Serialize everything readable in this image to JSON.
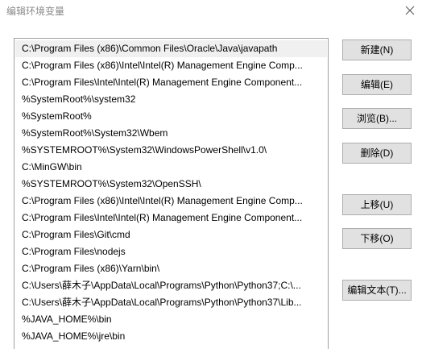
{
  "window": {
    "title": "编辑环境变量",
    "close_icon": "close-icon"
  },
  "paths": [
    "C:\\Program Files (x86)\\Common Files\\Oracle\\Java\\javapath",
    "C:\\Program Files (x86)\\Intel\\Intel(R) Management Engine Comp...",
    "C:\\Program Files\\Intel\\Intel(R) Management Engine Component...",
    "%SystemRoot%\\system32",
    "%SystemRoot%",
    "%SystemRoot%\\System32\\Wbem",
    "%SYSTEMROOT%\\System32\\WindowsPowerShell\\v1.0\\",
    "C:\\MinGW\\bin",
    "%SYSTEMROOT%\\System32\\OpenSSH\\",
    "C:\\Program Files (x86)\\Intel\\Intel(R) Management Engine Comp...",
    "C:\\Program Files\\Intel\\Intel(R) Management Engine Component...",
    "C:\\Program Files\\Git\\cmd",
    "C:\\Program Files\\nodejs",
    "C:\\Program Files (x86)\\Yarn\\bin\\",
    "C:\\Users\\薛木子\\AppData\\Local\\Programs\\Python\\Python37;C:\\...",
    "C:\\Users\\薛木子\\AppData\\Local\\Programs\\Python\\Python37\\Lib...",
    "%JAVA_HOME%\\bin",
    "%JAVA_HOME%\\jre\\bin"
  ],
  "selected_index": 0,
  "buttons": {
    "new": "新建(N)",
    "edit": "编辑(E)",
    "browse": "浏览(B)...",
    "delete": "删除(D)",
    "move_up": "上移(U)",
    "move_down": "下移(O)",
    "edit_text": "编辑文本(T)..."
  },
  "colors": {
    "selected_row": "#f0f0f0",
    "button_bg": "#e1e1e1",
    "button_border": "#adadad",
    "list_border": "#a0a0a0"
  }
}
